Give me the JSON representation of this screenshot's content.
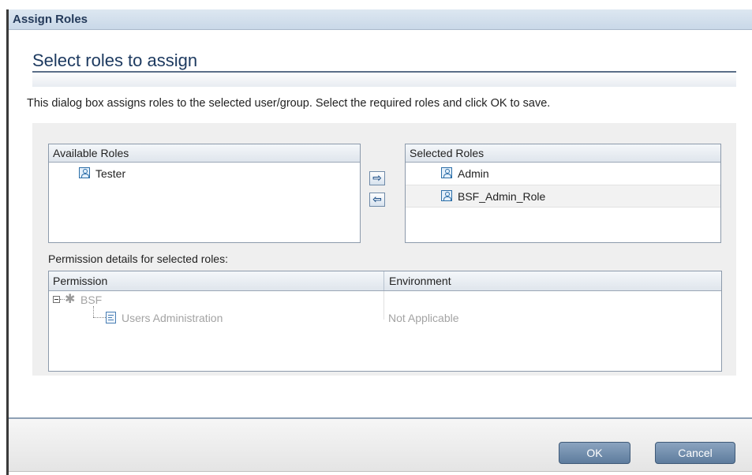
{
  "dialog": {
    "title": "Assign Roles",
    "heading": "Select roles to assign",
    "description": "This dialog box assigns roles to the selected user/group. Select the required roles and click OK to save."
  },
  "available_roles": {
    "header": "Available Roles",
    "items": [
      {
        "label": "Tester",
        "icon": "user-role-icon"
      }
    ]
  },
  "selected_roles": {
    "header": "Selected Roles",
    "items": [
      {
        "label": "Admin",
        "icon": "user-role-icon"
      },
      {
        "label": "BSF_Admin_Role",
        "icon": "user-role-icon"
      }
    ]
  },
  "transfer_buttons": {
    "add_glyph": "⇨",
    "remove_glyph": "⇦"
  },
  "permissions": {
    "label": "Permission details for selected roles:",
    "columns": [
      "Permission",
      "Environment"
    ],
    "tree": {
      "node": {
        "label": "BSF",
        "icon": "gear-icon",
        "expanded": true
      },
      "children": [
        {
          "label": "Users Administration",
          "environment": "Not Applicable",
          "icon": "document-icon"
        }
      ]
    }
  },
  "footer": {
    "ok_label": "OK",
    "cancel_label": "Cancel"
  }
}
